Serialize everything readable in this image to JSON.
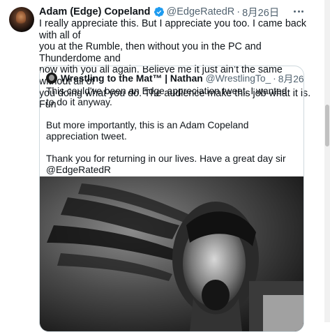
{
  "tweet": {
    "display_name": "Adam (Edge) Copeland",
    "handle": "@EdgeRatedR",
    "separator": "·",
    "date": "8月26日",
    "text": "I really appreciate this. But I appreciate you too. I came back with all of\nyou at the Rumble, then without you in the PC and Thunderdome and\nnow with you all again. Believe me it just ain’t the same without all of\nyou doing what you do. The audience make this job what it is. Fun",
    "verified_color": "#1d9bf0"
  },
  "quote": {
    "display_name": "Wrestling to the Mat™ | Nathan",
    "handle": "@WrestlingTo_",
    "separator": "·",
    "date": "8月26日",
    "paragraphs": [
      "This could've been an Edge appreciation tweet. I wanted to do it anyway.",
      "But more importantly, this is an Adam Copeland appreciation tweet.",
      "Thank you for returning in our lives. Have a great day sir @EdgeRatedR"
    ]
  },
  "icons": {
    "verified": "verified-badge-icon",
    "more": "more-horizontal-icon"
  }
}
